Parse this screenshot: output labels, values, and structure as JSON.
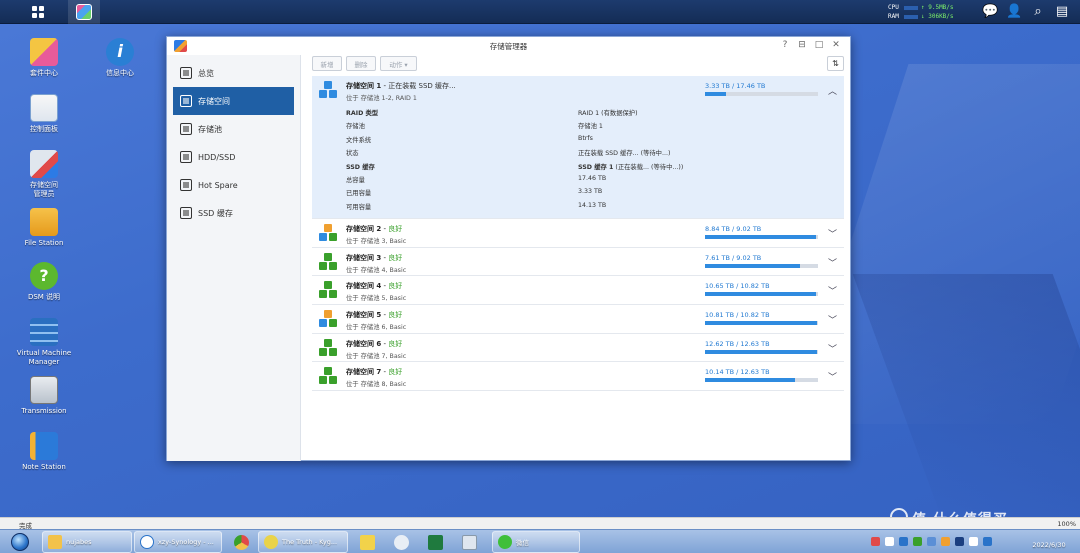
{
  "topbar": {
    "cpu_label": "CPU",
    "ram_label": "RAM",
    "upload_speed": "9.5MB/s",
    "download_speed": "306KB/s"
  },
  "desktop_icons": [
    {
      "label": "套件中心"
    },
    {
      "label": "信息中心"
    },
    {
      "label": "控制面板"
    },
    {
      "label": "存储空间\n管理员"
    },
    {
      "label": "File Station"
    },
    {
      "label": "DSM 说明"
    },
    {
      "label": "Virtual Machine\nManager"
    },
    {
      "label": "Transmission"
    },
    {
      "label": "Note Station"
    }
  ],
  "window": {
    "title": "存储管理器",
    "controls": {
      "help": "?",
      "pin": "⊟",
      "maximize": "□",
      "close": "✕"
    }
  },
  "sidebar": {
    "items": [
      {
        "label": "总览",
        "active": false
      },
      {
        "label": "存储空间",
        "active": true
      },
      {
        "label": "存储池",
        "active": false
      },
      {
        "label": "HDD/SSD",
        "active": false
      },
      {
        "label": "Hot Spare",
        "active": false
      },
      {
        "label": "SSD 缓存",
        "active": false
      }
    ]
  },
  "toolbar": {
    "new_label": "新增",
    "delete_label": "删除",
    "action_label": "动作 ▾",
    "sort_label": "⇅"
  },
  "volumes": [
    {
      "name": "存储空间 1",
      "status": "正在装载 SSD 缓存...",
      "location": "位于 存储池 1-2, RAID 1",
      "capacity_text": "3.33 TB / 17.46 TB",
      "used_fraction": 0.19,
      "expanded": true,
      "details": [
        {
          "key": "RAID 类型",
          "value": "RAID 1 (有数据保护)"
        },
        {
          "key": "存储池",
          "value": "存储池 1"
        },
        {
          "key": "文件系统",
          "value": "Btrfs"
        },
        {
          "key": "状态",
          "value": "正在装载 SSD 缓存... (等待中...)"
        },
        {
          "key": "SSD 缓存",
          "value": "SSD 缓存 1",
          "value_suffix": " (正在装载... (等待中...))"
        },
        {
          "key": "总容量",
          "value": "17.46 TB"
        },
        {
          "key": "已用容量",
          "value": "3.33 TB"
        },
        {
          "key": "可用容量",
          "value": "14.13 TB"
        }
      ]
    },
    {
      "name": "存储空间 2",
      "status": "良好",
      "location": "位于 存储池 3, Basic",
      "capacity_text": "8.84 TB / 9.02 TB",
      "used_fraction": 0.98,
      "expanded": false
    },
    {
      "name": "存储空间 3",
      "status": "良好",
      "location": "位于 存储池 4, Basic",
      "capacity_text": "7.61 TB / 9.02 TB",
      "used_fraction": 0.84,
      "expanded": false
    },
    {
      "name": "存储空间 4",
      "status": "良好",
      "location": "位于 存储池 5, Basic",
      "capacity_text": "10.65 TB / 10.82 TB",
      "used_fraction": 0.98,
      "expanded": false
    },
    {
      "name": "存储空间 5",
      "status": "良好",
      "location": "位于 存储池 6, Basic",
      "capacity_text": "10.81 TB / 10.82 TB",
      "used_fraction": 0.99,
      "expanded": false
    },
    {
      "name": "存储空间 6",
      "status": "良好",
      "location": "位于 存储池 7, Basic",
      "capacity_text": "12.62 TB / 12.63 TB",
      "used_fraction": 0.99,
      "expanded": false
    },
    {
      "name": "存储空间 7",
      "status": "良好",
      "location": "位于 存储池 8, Basic",
      "capacity_text": "10.14 TB / 12.63 TB",
      "used_fraction": 0.8,
      "expanded": false
    }
  ],
  "statusbar": {
    "status_text": "完成",
    "zoom": "100%"
  },
  "taskbar": {
    "tasks": [
      {
        "label": "nujabes"
      },
      {
        "label": "xzy-Synology - ..."
      },
      {
        "label": "The Truth - Kyg..."
      },
      {
        "label": "微信"
      }
    ],
    "clock_date": "2022/6/30"
  },
  "watermark": "值 什么值得买",
  "colors": {
    "accent": "#1f5fa5",
    "capacity_bar": "#2f8be0",
    "status_good": "#3aa02b",
    "desktop": "#3d6ccc"
  }
}
